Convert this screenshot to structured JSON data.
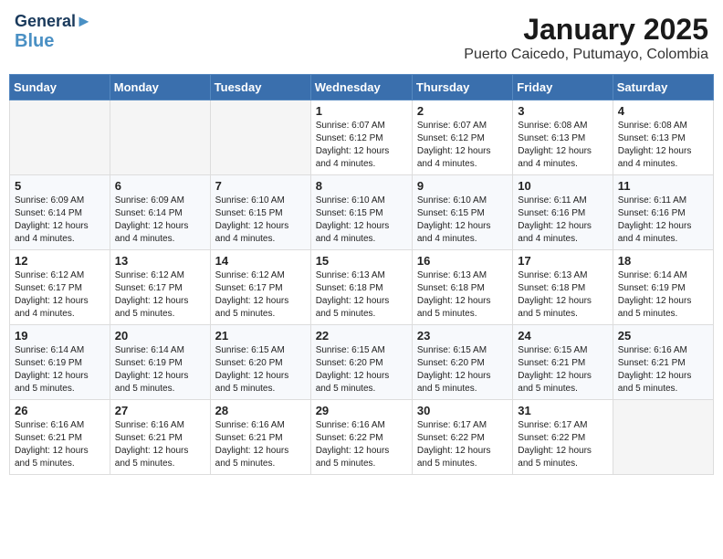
{
  "header": {
    "logo_line1": "General",
    "logo_line2": "Blue",
    "title": "January 2025",
    "subtitle": "Puerto Caicedo, Putumayo, Colombia"
  },
  "weekdays": [
    "Sunday",
    "Monday",
    "Tuesday",
    "Wednesday",
    "Thursday",
    "Friday",
    "Saturday"
  ],
  "weeks": [
    [
      {
        "day": "",
        "info": ""
      },
      {
        "day": "",
        "info": ""
      },
      {
        "day": "",
        "info": ""
      },
      {
        "day": "1",
        "info": "Sunrise: 6:07 AM\nSunset: 6:12 PM\nDaylight: 12 hours\nand 4 minutes."
      },
      {
        "day": "2",
        "info": "Sunrise: 6:07 AM\nSunset: 6:12 PM\nDaylight: 12 hours\nand 4 minutes."
      },
      {
        "day": "3",
        "info": "Sunrise: 6:08 AM\nSunset: 6:13 PM\nDaylight: 12 hours\nand 4 minutes."
      },
      {
        "day": "4",
        "info": "Sunrise: 6:08 AM\nSunset: 6:13 PM\nDaylight: 12 hours\nand 4 minutes."
      }
    ],
    [
      {
        "day": "5",
        "info": "Sunrise: 6:09 AM\nSunset: 6:14 PM\nDaylight: 12 hours\nand 4 minutes."
      },
      {
        "day": "6",
        "info": "Sunrise: 6:09 AM\nSunset: 6:14 PM\nDaylight: 12 hours\nand 4 minutes."
      },
      {
        "day": "7",
        "info": "Sunrise: 6:10 AM\nSunset: 6:15 PM\nDaylight: 12 hours\nand 4 minutes."
      },
      {
        "day": "8",
        "info": "Sunrise: 6:10 AM\nSunset: 6:15 PM\nDaylight: 12 hours\nand 4 minutes."
      },
      {
        "day": "9",
        "info": "Sunrise: 6:10 AM\nSunset: 6:15 PM\nDaylight: 12 hours\nand 4 minutes."
      },
      {
        "day": "10",
        "info": "Sunrise: 6:11 AM\nSunset: 6:16 PM\nDaylight: 12 hours\nand 4 minutes."
      },
      {
        "day": "11",
        "info": "Sunrise: 6:11 AM\nSunset: 6:16 PM\nDaylight: 12 hours\nand 4 minutes."
      }
    ],
    [
      {
        "day": "12",
        "info": "Sunrise: 6:12 AM\nSunset: 6:17 PM\nDaylight: 12 hours\nand 4 minutes."
      },
      {
        "day": "13",
        "info": "Sunrise: 6:12 AM\nSunset: 6:17 PM\nDaylight: 12 hours\nand 5 minutes."
      },
      {
        "day": "14",
        "info": "Sunrise: 6:12 AM\nSunset: 6:17 PM\nDaylight: 12 hours\nand 5 minutes."
      },
      {
        "day": "15",
        "info": "Sunrise: 6:13 AM\nSunset: 6:18 PM\nDaylight: 12 hours\nand 5 minutes."
      },
      {
        "day": "16",
        "info": "Sunrise: 6:13 AM\nSunset: 6:18 PM\nDaylight: 12 hours\nand 5 minutes."
      },
      {
        "day": "17",
        "info": "Sunrise: 6:13 AM\nSunset: 6:18 PM\nDaylight: 12 hours\nand 5 minutes."
      },
      {
        "day": "18",
        "info": "Sunrise: 6:14 AM\nSunset: 6:19 PM\nDaylight: 12 hours\nand 5 minutes."
      }
    ],
    [
      {
        "day": "19",
        "info": "Sunrise: 6:14 AM\nSunset: 6:19 PM\nDaylight: 12 hours\nand 5 minutes."
      },
      {
        "day": "20",
        "info": "Sunrise: 6:14 AM\nSunset: 6:19 PM\nDaylight: 12 hours\nand 5 minutes."
      },
      {
        "day": "21",
        "info": "Sunrise: 6:15 AM\nSunset: 6:20 PM\nDaylight: 12 hours\nand 5 minutes."
      },
      {
        "day": "22",
        "info": "Sunrise: 6:15 AM\nSunset: 6:20 PM\nDaylight: 12 hours\nand 5 minutes."
      },
      {
        "day": "23",
        "info": "Sunrise: 6:15 AM\nSunset: 6:20 PM\nDaylight: 12 hours\nand 5 minutes."
      },
      {
        "day": "24",
        "info": "Sunrise: 6:15 AM\nSunset: 6:21 PM\nDaylight: 12 hours\nand 5 minutes."
      },
      {
        "day": "25",
        "info": "Sunrise: 6:16 AM\nSunset: 6:21 PM\nDaylight: 12 hours\nand 5 minutes."
      }
    ],
    [
      {
        "day": "26",
        "info": "Sunrise: 6:16 AM\nSunset: 6:21 PM\nDaylight: 12 hours\nand 5 minutes."
      },
      {
        "day": "27",
        "info": "Sunrise: 6:16 AM\nSunset: 6:21 PM\nDaylight: 12 hours\nand 5 minutes."
      },
      {
        "day": "28",
        "info": "Sunrise: 6:16 AM\nSunset: 6:21 PM\nDaylight: 12 hours\nand 5 minutes."
      },
      {
        "day": "29",
        "info": "Sunrise: 6:16 AM\nSunset: 6:22 PM\nDaylight: 12 hours\nand 5 minutes."
      },
      {
        "day": "30",
        "info": "Sunrise: 6:17 AM\nSunset: 6:22 PM\nDaylight: 12 hours\nand 5 minutes."
      },
      {
        "day": "31",
        "info": "Sunrise: 6:17 AM\nSunset: 6:22 PM\nDaylight: 12 hours\nand 5 minutes."
      },
      {
        "day": "",
        "info": ""
      }
    ]
  ]
}
